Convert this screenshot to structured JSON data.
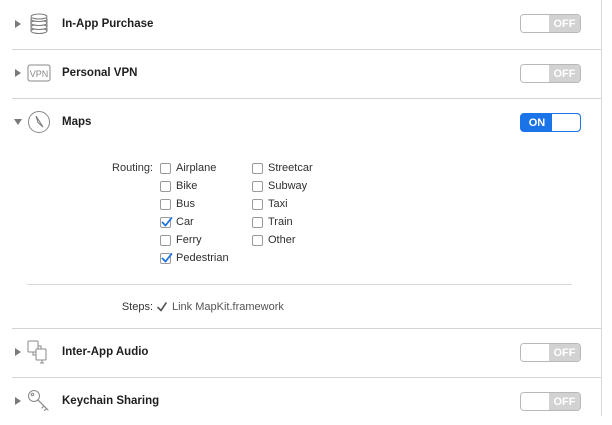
{
  "capabilities": [
    {
      "title": "In-App Purchase",
      "icon": "coins-stack-icon",
      "state": "OFF"
    },
    {
      "title": "Personal VPN",
      "icon": "vpn-icon",
      "icon_text": "VPN",
      "state": "OFF"
    },
    {
      "title": "Maps",
      "icon": "compass-icon",
      "state": "ON"
    },
    {
      "title": "Inter-App Audio",
      "icon": "audio-windows-icon",
      "state": "OFF"
    },
    {
      "title": "Keychain Sharing",
      "icon": "key-icon",
      "state": "OFF"
    }
  ],
  "maps": {
    "routing_label": "Routing:",
    "routing_col1": [
      {
        "label": "Airplane",
        "checked": false
      },
      {
        "label": "Bike",
        "checked": false
      },
      {
        "label": "Bus",
        "checked": false
      },
      {
        "label": "Car",
        "checked": true
      },
      {
        "label": "Ferry",
        "checked": false
      },
      {
        "label": "Pedestrian",
        "checked": true
      }
    ],
    "routing_col2": [
      {
        "label": "Streetcar",
        "checked": false
      },
      {
        "label": "Subway",
        "checked": false
      },
      {
        "label": "Taxi",
        "checked": false
      },
      {
        "label": "Train",
        "checked": false
      },
      {
        "label": "Other",
        "checked": false
      }
    ],
    "steps_label": "Steps:",
    "steps": [
      {
        "text": "Link MapKit.framework",
        "done": true
      }
    ]
  },
  "colors": {
    "accent": "#1b73e8",
    "check": "#1b73e8"
  }
}
